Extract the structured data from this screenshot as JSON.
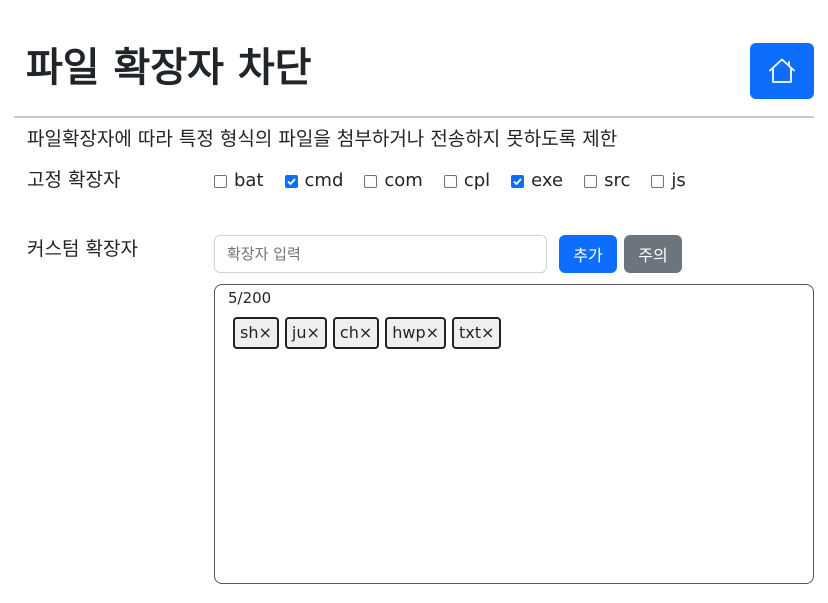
{
  "header": {
    "title": "파일 확장자 차단",
    "home_icon": "home-icon"
  },
  "description": "파일확장자에 따라 특정 형식의 파일을 첨부하거나 전송하지 못하도록 제한",
  "fixed": {
    "label": "고정 확장자",
    "extensions": [
      {
        "name": "bat",
        "checked": false
      },
      {
        "name": "cmd",
        "checked": true
      },
      {
        "name": "com",
        "checked": false
      },
      {
        "name": "cpl",
        "checked": false
      },
      {
        "name": "exe",
        "checked": true
      },
      {
        "name": "src",
        "checked": false
      },
      {
        "name": "js",
        "checked": false
      }
    ]
  },
  "custom": {
    "label": "커스텀 확장자",
    "input_placeholder": "확장자 입력",
    "input_value": "",
    "add_label": "추가",
    "caution_label": "주의",
    "count": "5/200",
    "remove_symbol": "×",
    "tags": [
      "sh",
      "ju",
      "ch",
      "hwp",
      "txt"
    ]
  },
  "colors": {
    "primary": "#0d6efd",
    "secondary": "#6c757d"
  }
}
